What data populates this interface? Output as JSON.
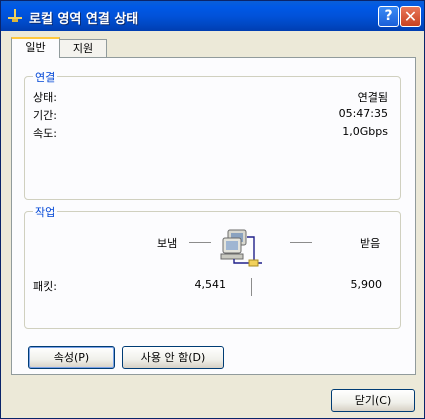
{
  "window": {
    "title": "로컬 영역 연결 상태"
  },
  "tabs": [
    {
      "label": "일반",
      "active": true
    },
    {
      "label": "지원",
      "active": false
    }
  ],
  "connection": {
    "group_label": "연결",
    "status_label": "상태:",
    "status_value": "연결됨",
    "duration_label": "기간:",
    "duration_value": "05:47:35",
    "speed_label": "속도:",
    "speed_value": "1,0Gbps"
  },
  "activity": {
    "group_label": "작업",
    "sent_label": "보냄",
    "received_label": "받음",
    "packets_label": "패킷:",
    "packets_sent": "4,541",
    "packets_received": "5,900"
  },
  "buttons": {
    "properties": "속성(P)",
    "disable": "사용 안 함(D)",
    "close": "닫기(C)"
  },
  "icons": {
    "title": "network-connection-icon",
    "activity": "network-computers-icon"
  }
}
